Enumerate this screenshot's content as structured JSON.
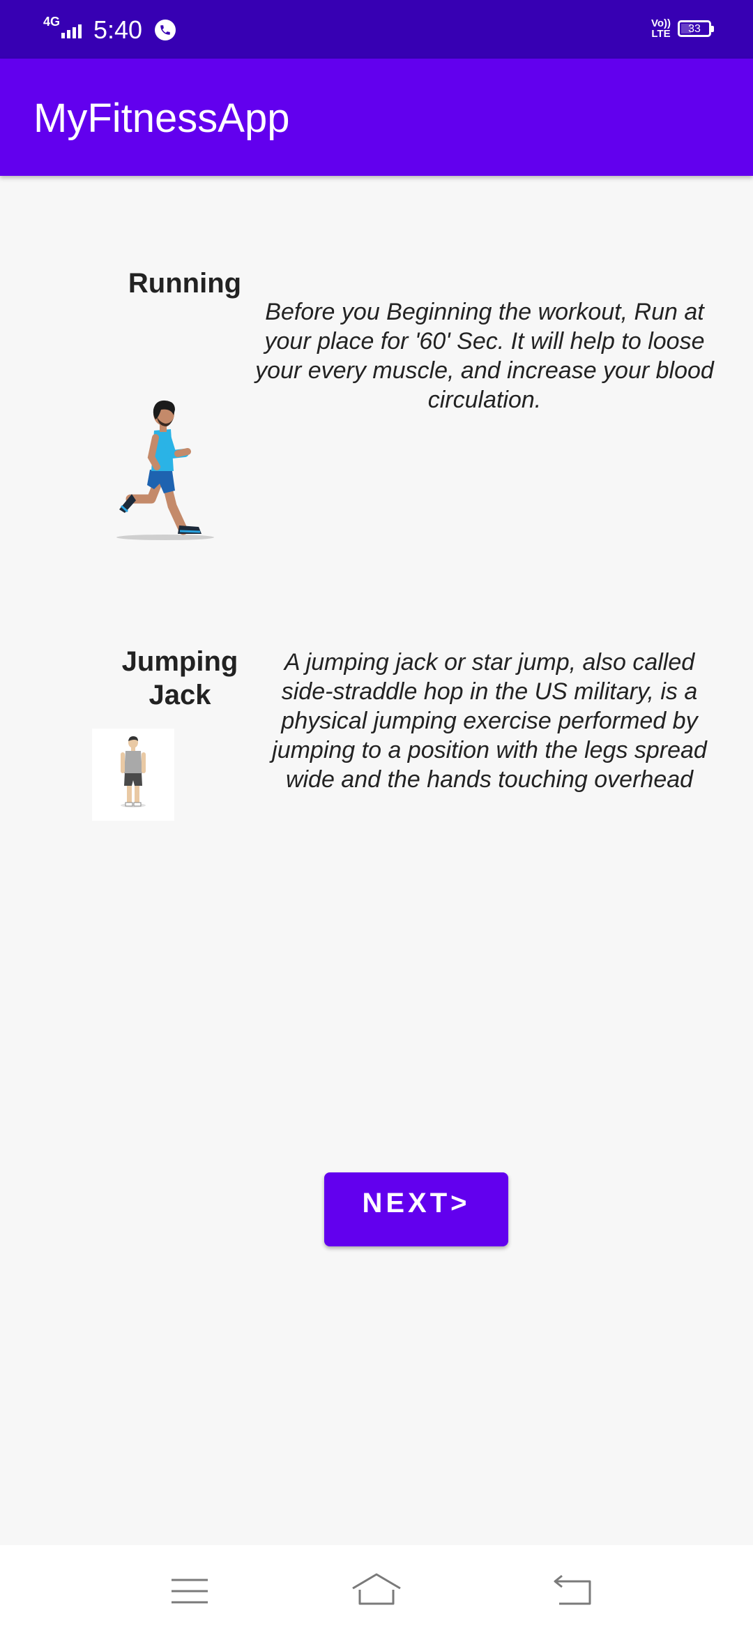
{
  "status_bar": {
    "network": "4G",
    "time": "5:40",
    "volte": "Vo)) LTE",
    "battery": "33",
    "battery_level": 0.33
  },
  "app_bar": {
    "title": "MyFitnessApp"
  },
  "exercises": [
    {
      "title": "Running",
      "description": "Before you Beginning the workout, Run at your place for '60' Sec. It will help to loose your every muscle, and increase your blood circulation.",
      "image": "running-man-illustration"
    },
    {
      "title": "Jumping Jack",
      "description": "A jumping jack or star jump, also called side-straddle hop in the US military, is a physical jumping exercise performed by jumping to a position with the legs spread wide and the hands touching overhead",
      "image": "standing-man-illustration"
    }
  ],
  "next_button": {
    "label": "NEXT>"
  },
  "nav_bar": {
    "items": [
      {
        "icon": "menu-icon"
      },
      {
        "icon": "home-icon"
      },
      {
        "icon": "back-icon"
      }
    ]
  },
  "colors": {
    "status_bar": "#3700b3",
    "primary": "#6200ee",
    "background": "#f7f7f7"
  }
}
